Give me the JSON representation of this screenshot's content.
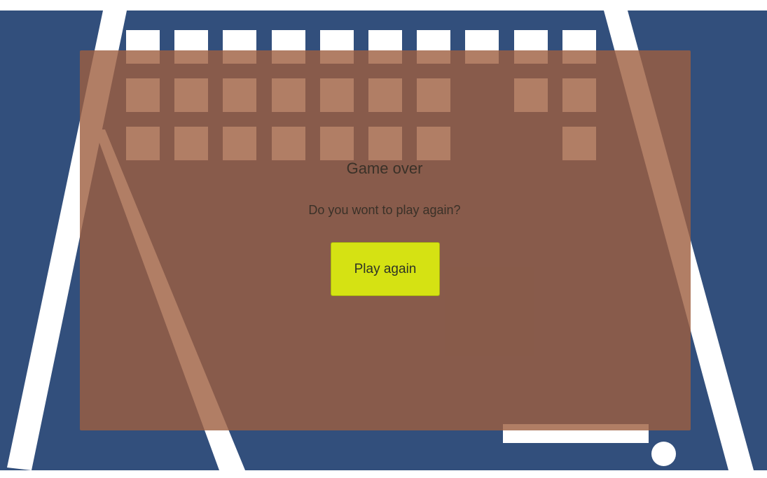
{
  "game": {
    "state": "game-over",
    "colors": {
      "field": "#324f7c",
      "walls": "#ffffff",
      "overlay": "#9d5e3e",
      "button": "#d5e213",
      "text": "#3a3128"
    },
    "bricks": {
      "rows": 3,
      "columns": 10,
      "remaining": [
        [
          true,
          true,
          true,
          true,
          true,
          true,
          true,
          true,
          true,
          true
        ],
        [
          true,
          true,
          true,
          true,
          true,
          true,
          true,
          false,
          true,
          true
        ],
        [
          true,
          true,
          true,
          true,
          true,
          true,
          true,
          false,
          false,
          true
        ]
      ]
    },
    "paddle_icon": "paddle",
    "ball_icon": "ball"
  },
  "overlay": {
    "title": "Game over",
    "subtitle": "Do you wont to play again?",
    "play_again_label": "Play again"
  }
}
